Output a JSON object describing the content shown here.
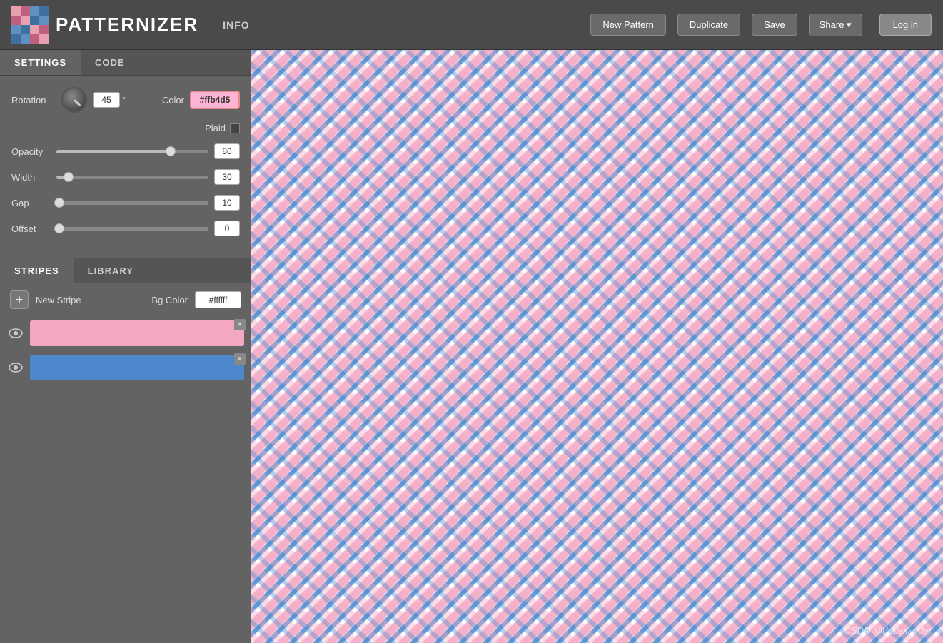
{
  "header": {
    "logo_text": "PATTERNIZER",
    "info_label": "INFO",
    "new_pattern_label": "New Pattern",
    "duplicate_label": "Duplicate",
    "save_label": "Save",
    "share_label": "Share ▾",
    "login_label": "Log in"
  },
  "tabs": {
    "settings_label": "SETTINGS",
    "code_label": "CODE"
  },
  "settings": {
    "rotation_label": "Rotation",
    "rotation_value": "45",
    "rotation_unit": "°",
    "color_label": "Color",
    "color_value": "#ffb4d5",
    "plaid_label": "Plaid",
    "opacity_label": "Opacity",
    "opacity_value": "80",
    "opacity_pct": 0.75,
    "width_label": "Width",
    "width_value": "30",
    "width_pct": 0.08,
    "gap_label": "Gap",
    "gap_value": "10",
    "gap_pct": 0.02,
    "offset_label": "Offset",
    "offset_value": "0",
    "offset_pct": 0.02
  },
  "stripes": {
    "stripes_tab_label": "STRIPES",
    "library_tab_label": "LIBRARY",
    "new_stripe_label": "New Stripe",
    "bg_color_label": "Bg Color",
    "bg_color_value": "#ffffff",
    "items": [
      {
        "color": "#f4a7c3",
        "visible": true
      },
      {
        "color": "#4d87cc",
        "visible": true
      }
    ]
  },
  "watermark": "CSDN @dralexander"
}
